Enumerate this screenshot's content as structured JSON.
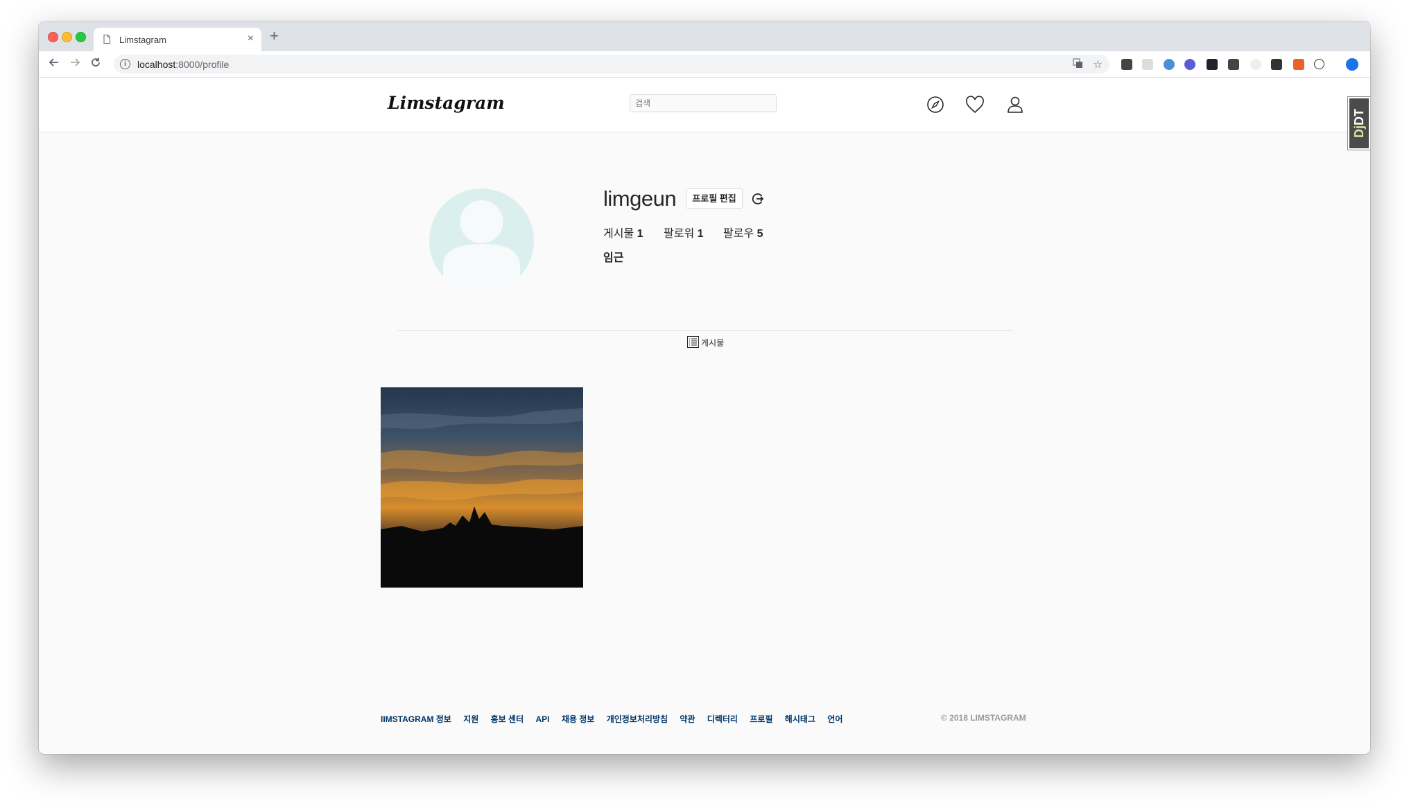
{
  "browser": {
    "tab_title": "Limstagram",
    "tab_close": "×",
    "new_tab": "+",
    "url_host": "localhost",
    "url_rest": ":8000/profile"
  },
  "site": {
    "logo": "Limstagram",
    "search_placeholder": "검색"
  },
  "profile": {
    "username": "limgeun",
    "edit_button": "프로필 편집",
    "stats": [
      {
        "label": "게시물",
        "value": "1"
      },
      {
        "label": "팔로워",
        "value": "1"
      },
      {
        "label": "팔로우",
        "value": "5"
      }
    ],
    "full_name": "임근",
    "posts_tab_label": "게시물"
  },
  "footer": {
    "links": [
      "lIMSTAGRAM 정보",
      "지원",
      "홍보 센터",
      "API",
      "채용 정보",
      "개인정보처리방침",
      "약관",
      "디렉터리",
      "프로필",
      "해시태그",
      "언어"
    ],
    "copyright": "© 2018 LIMSTAGRAM"
  },
  "devtools_tab": "DjDT",
  "colors": {
    "accent": "#003569",
    "avatar_bg": "#dcefef",
    "page_bg": "#fafafa"
  }
}
